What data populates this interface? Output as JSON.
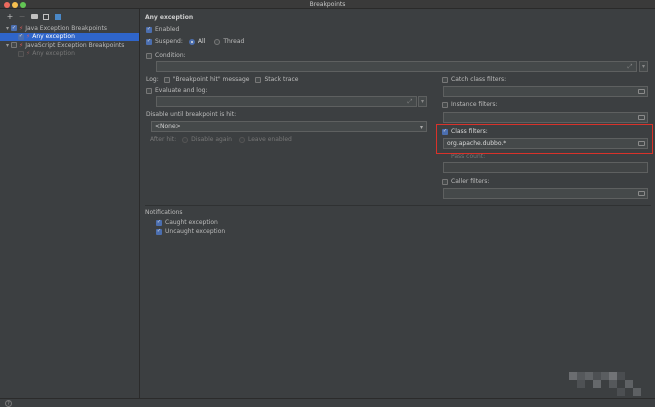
{
  "window": {
    "title": "Breakpoints"
  },
  "toolbar": {
    "add": "+",
    "remove": "−"
  },
  "tree": {
    "items": [
      {
        "label": "Java Exception Breakpoints",
        "expanded": true,
        "checked": true
      },
      {
        "label": "Any exception",
        "checked": true,
        "selected": true
      },
      {
        "label": "JavaScript Exception Breakpoints",
        "expanded": true,
        "checked": false
      },
      {
        "label": "Any exception",
        "checked": false,
        "disabled": true
      }
    ]
  },
  "details": {
    "header": "Any exception",
    "enabled_label": "Enabled",
    "suspend_label": "Suspend:",
    "suspend_all": "All",
    "suspend_thread": "Thread",
    "condition_label": "Condition:",
    "log_label": "Log:",
    "log_message": "\"Breakpoint hit\" message",
    "stack_trace": "Stack trace",
    "evaluate_log": "Evaluate and log:",
    "disable_until": "Disable until breakpoint is hit:",
    "disable_value": "<None>",
    "after_hit": "After hit:",
    "disable_again": "Disable again",
    "leave_enabled": "Leave enabled",
    "notifications_title": "Notifications",
    "caught_exception": "Caught exception",
    "uncaught_exception": "Uncaught exception"
  },
  "filters": {
    "catch_class": "Catch class filters:",
    "instance": "Instance filters:",
    "class_filters": "Class filters:",
    "class_filters_value": "org.apache.dubbo.*",
    "pass_count": "Pass count:",
    "caller": "Caller filters:"
  },
  "status": {
    "help": "?"
  },
  "colors": {
    "selection": "#2f65ca",
    "highlight": "#d9322a",
    "accent": "#4b6eaf"
  }
}
